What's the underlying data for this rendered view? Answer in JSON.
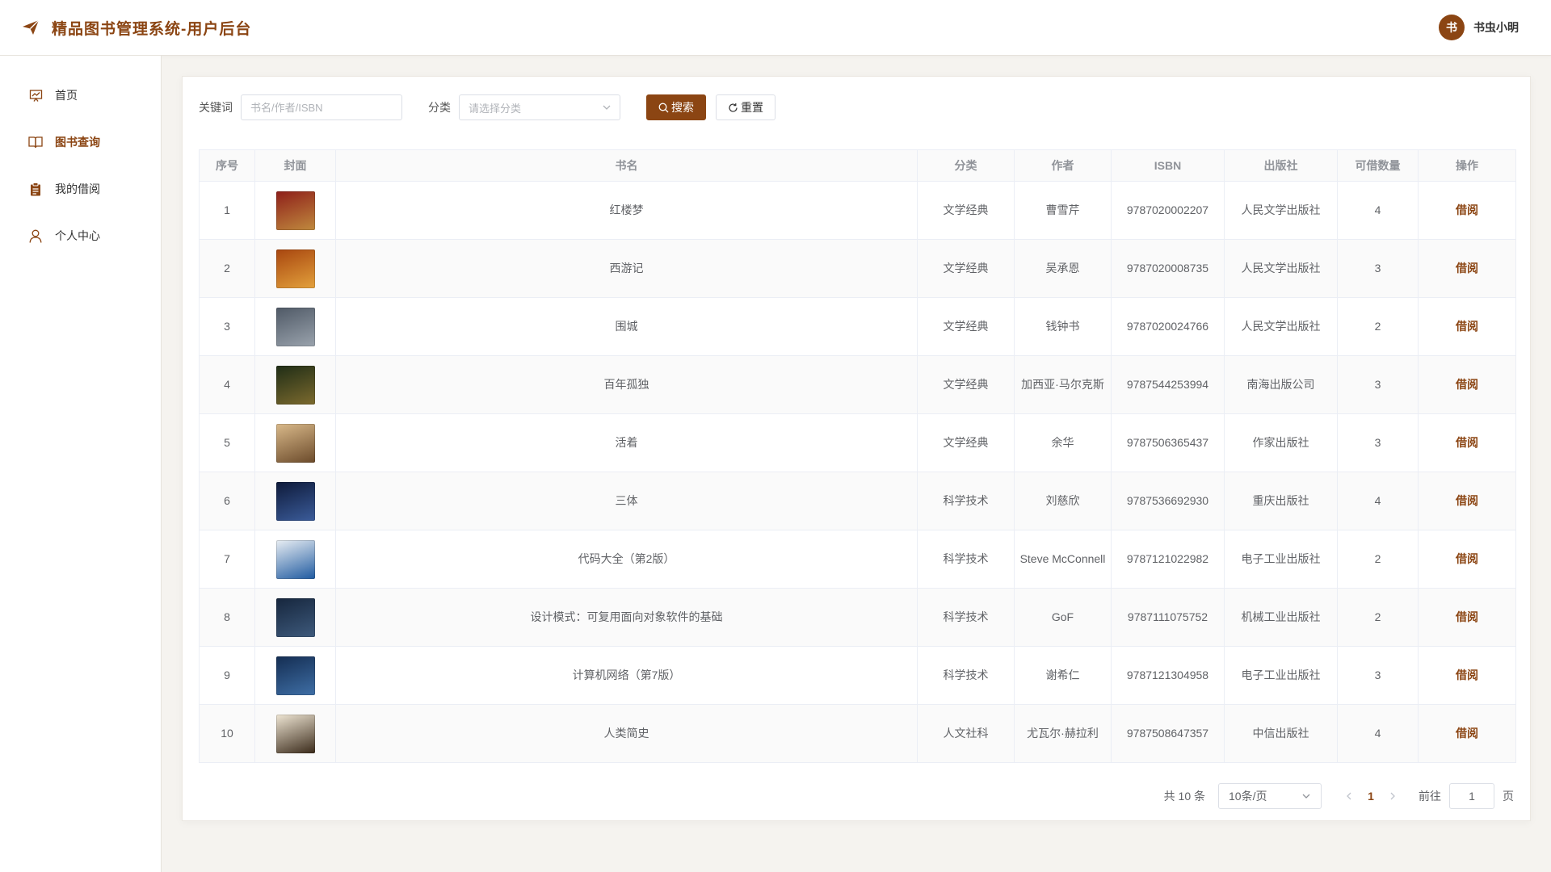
{
  "header": {
    "title": "精品图书管理系统-用户后台",
    "user_avatar_text": "书",
    "username": "书虫小明"
  },
  "sidebar": {
    "items": [
      {
        "label": "首页",
        "icon": "dashboard-icon"
      },
      {
        "label": "图书查询",
        "icon": "book-open-icon",
        "active": true
      },
      {
        "label": "我的借阅",
        "icon": "clipboard-icon"
      },
      {
        "label": "个人中心",
        "icon": "user-icon"
      }
    ]
  },
  "filters": {
    "keyword_label": "关键词",
    "keyword_placeholder": "书名/作者/ISBN",
    "category_label": "分类",
    "category_placeholder": "请选择分类",
    "search_button": "搜索",
    "reset_button": "重置"
  },
  "table": {
    "columns": [
      "序号",
      "封面",
      "书名",
      "分类",
      "作者",
      "ISBN",
      "出版社",
      "可借数量",
      "操作"
    ],
    "action_label": "借阅",
    "rows": [
      {
        "no": "1",
        "title": "红楼梦",
        "category": "文学经典",
        "author": "曹雪芹",
        "isbn": "9787020002207",
        "publisher": "人民文学出版社",
        "available": "4",
        "cover_colors": [
          "#8e1f1a",
          "#c08a3e"
        ]
      },
      {
        "no": "2",
        "title": "西游记",
        "category": "文学经典",
        "author": "吴承恩",
        "isbn": "9787020008735",
        "publisher": "人民文学出版社",
        "available": "3",
        "cover_colors": [
          "#a8460f",
          "#e3a13c"
        ]
      },
      {
        "no": "3",
        "title": "围城",
        "category": "文学经典",
        "author": "钱钟书",
        "isbn": "9787020024766",
        "publisher": "人民文学出版社",
        "available": "2",
        "cover_colors": [
          "#4f5966",
          "#9aa3ad"
        ]
      },
      {
        "no": "4",
        "title": "百年孤独",
        "category": "文学经典",
        "author": "加西亚·马尔克斯",
        "isbn": "9787544253994",
        "publisher": "南海出版公司",
        "available": "3",
        "cover_colors": [
          "#1f2d16",
          "#7c6a2e"
        ]
      },
      {
        "no": "5",
        "title": "活着",
        "category": "文学经典",
        "author": "余华",
        "isbn": "9787506365437",
        "publisher": "作家出版社",
        "available": "3",
        "cover_colors": [
          "#d9b98a",
          "#6b4a2a"
        ]
      },
      {
        "no": "6",
        "title": "三体",
        "category": "科学技术",
        "author": "刘慈欣",
        "isbn": "9787536692930",
        "publisher": "重庆出版社",
        "available": "4",
        "cover_colors": [
          "#0e1a3a",
          "#3b5c9a"
        ]
      },
      {
        "no": "7",
        "title": "代码大全（第2版）",
        "category": "科学技术",
        "author": "Steve McConnell",
        "isbn": "9787121022982",
        "publisher": "电子工业出版社",
        "available": "2",
        "cover_colors": [
          "#e9eef3",
          "#1f5aa0"
        ]
      },
      {
        "no": "8",
        "title": "设计模式：可复用面向对象软件的基础",
        "category": "科学技术",
        "author": "GoF",
        "isbn": "9787111075752",
        "publisher": "机械工业出版社",
        "available": "2",
        "cover_colors": [
          "#16263d",
          "#3e5a7c"
        ]
      },
      {
        "no": "9",
        "title": "计算机网络（第7版）",
        "category": "科学技术",
        "author": "谢希仁",
        "isbn": "9787121304958",
        "publisher": "电子工业出版社",
        "available": "3",
        "cover_colors": [
          "#142d52",
          "#3f6fa6"
        ]
      },
      {
        "no": "10",
        "title": "人类简史",
        "category": "人文社科",
        "author": "尤瓦尔·赫拉利",
        "isbn": "9787508647357",
        "publisher": "中信出版社",
        "available": "4",
        "cover_colors": [
          "#efe6d4",
          "#3a2a1a"
        ]
      }
    ]
  },
  "pagination": {
    "total_text": "共 10 条",
    "page_size": "10条/页",
    "current_page": "1",
    "goto_label": "前往",
    "goto_value": "1",
    "page_unit": "页"
  },
  "colors": {
    "accent": "#8b4513",
    "background": "#f5f3ef"
  }
}
